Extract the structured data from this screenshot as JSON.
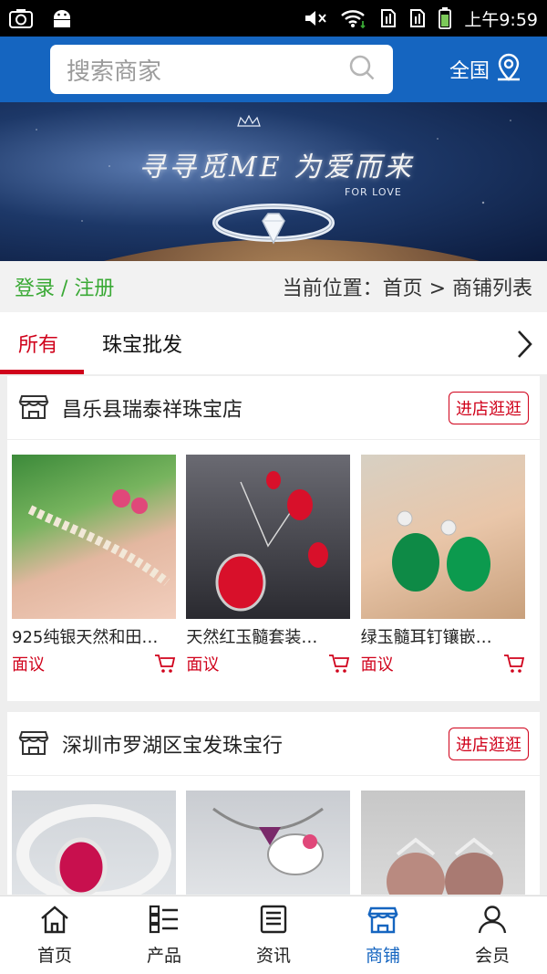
{
  "statusbar": {
    "time": "上午9:59"
  },
  "header": {
    "search_placeholder": "搜索商家",
    "region": "全国"
  },
  "banner": {
    "title": "寻寻觅ME 为爱而来",
    "subtitle": "FOR LOVE"
  },
  "crumbbar": {
    "login": "登录 / 注册",
    "location": "当前位置：首页 > 商铺列表"
  },
  "tabs": {
    "items": [
      "所有",
      "珠宝批发"
    ],
    "active": "所有"
  },
  "shops": [
    {
      "name": "昌乐县瑞泰祥珠宝店",
      "button": "进店逛逛",
      "products": [
        {
          "name": "925纯银天然和田…",
          "price": "面议"
        },
        {
          "name": "天然红玉髓套装…",
          "price": "面议"
        },
        {
          "name": "绿玉髓耳钉镶嵌…",
          "price": "面议"
        }
      ]
    },
    {
      "name": "深圳市罗湖区宝发珠宝行",
      "button": "进店逛逛",
      "products": [
        {
          "name": "",
          "price": ""
        },
        {
          "name": "",
          "price": ""
        },
        {
          "name": "",
          "price": ""
        }
      ]
    }
  ],
  "tabbar": {
    "items": [
      "首页",
      "产品",
      "资讯",
      "商铺",
      "会员"
    ],
    "active": "商铺"
  },
  "colors": {
    "primary": "#1565c0",
    "accent": "#d0021b",
    "login_green": "#3aa935"
  }
}
